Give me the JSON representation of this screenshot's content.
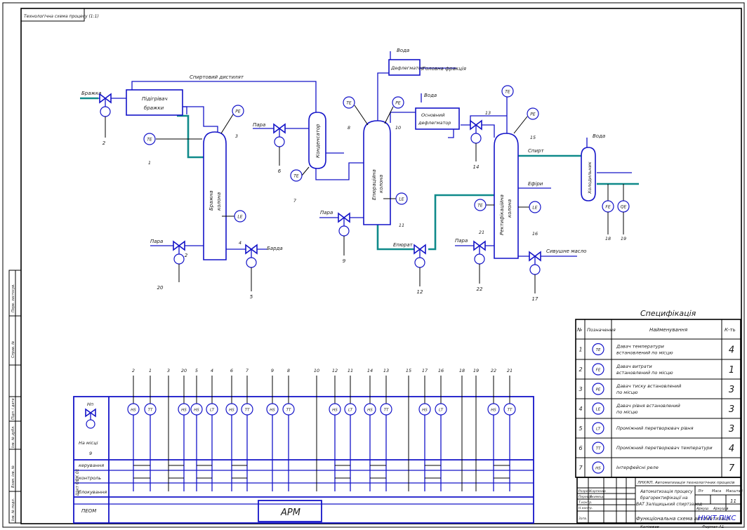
{
  "stamp_corner": "Технологічна схема процесу (1:1)",
  "diagram": {
    "streams": {
      "brazhka_in": "Бражка",
      "spirt_vidpr": "Спиртовий дистилят",
      "para_1": "Пара",
      "para_2": "Пара",
      "para_3": "Пара",
      "para_4": "Пара",
      "barda": "Барда",
      "voda_1": "Вода",
      "voda_2": "Вода",
      "voda_3": "Вода",
      "golovna_fr": "Головна фракція",
      "epyurat": "Епюрат",
      "spirt_out": "Спирт",
      "efiry": "Ефіри",
      "sivushni": "Сивушне масло"
    },
    "equipment": {
      "pidigrivach": [
        "Підігрівач",
        "бражки"
      ],
      "kolona_brazhna": [
        "Бражна",
        "колона"
      ],
      "kondensator": "Конденсатор",
      "kolona_epyur": [
        "Епюраційна",
        "колона"
      ],
      "defleg_1": "Дефлегматор",
      "defleg_2": [
        "Основний",
        "дефлегматор"
      ],
      "kolona_rekt": [
        "Ректифікаційна",
        "колона"
      ],
      "kholodylnyk": "Холодильник"
    },
    "instruments": {
      "i1": {
        "tag": "TE",
        "num": "1"
      },
      "i3": {
        "tag": "PE",
        "num": "3"
      },
      "i4": {
        "tag": "LE",
        "num": "4"
      },
      "i7": {
        "tag": "TE",
        "num": "7"
      },
      "i8": {
        "tag": "TE",
        "num": "8"
      },
      "i10": {
        "tag": "PE",
        "num": "10"
      },
      "i11": {
        "tag": "LE",
        "num": "11"
      },
      "i13": {
        "tag": "TE",
        "num": "13"
      },
      "i15": {
        "tag": "PE",
        "num": "15"
      },
      "i16": {
        "tag": "LE",
        "num": "16"
      },
      "i18": {
        "tag": "FE",
        "num": "18"
      },
      "i19": {
        "tag": "QE",
        "num": "19"
      },
      "i21": {
        "tag": "TE",
        "num": "21"
      }
    },
    "valves": {
      "v2": "2",
      "v5": "5",
      "v6": "6",
      "v9": "9",
      "v12": "12",
      "v14": "14",
      "v17": "17",
      "v20": "20",
      "v22": "22",
      "v2b": "2"
    }
  },
  "control_panel": {
    "top_numbers": [
      "2",
      "1",
      "3",
      "20",
      "5",
      "4",
      "6",
      "7",
      "9",
      "8",
      "10",
      "12",
      "11",
      "14",
      "13",
      "15",
      "17",
      "16",
      "18",
      "19",
      "22",
      "21"
    ],
    "field_devices": [
      "HS",
      "TT",
      "HS",
      "HS",
      "LT",
      "HS",
      "TT",
      "HS",
      "TT",
      "HS",
      "LT",
      "HS",
      "TT",
      "HS",
      "LT",
      "HS",
      "TT"
    ],
    "left_block": {
      "hn": "Нп",
      "label": "На місці",
      "num": "9"
    },
    "rows": [
      "керування",
      "контроль",
      "блокування"
    ],
    "cabinet_label": "Щит ОВК 01",
    "pc_label": "ПЕОМ",
    "arm_label": "АРМ"
  },
  "specification": {
    "title": "Специфікація",
    "headers": [
      "№",
      "Позначення",
      "Найменування",
      "К-ть"
    ],
    "rows": [
      {
        "n": "1",
        "sym": "TE",
        "name": [
          "Давач температури",
          "встановлений по місцю"
        ],
        "qty": "4"
      },
      {
        "n": "2",
        "sym": "FE",
        "name": [
          "Давач витрати",
          "встановлений по місцю"
        ],
        "qty": "1"
      },
      {
        "n": "3",
        "sym": "PE",
        "name": [
          "Давач тиску встановлений",
          "по місцю"
        ],
        "qty": "3"
      },
      {
        "n": "4",
        "sym": "LE",
        "name": [
          "Давач рівня встановлений",
          "по місцю"
        ],
        "qty": "3"
      },
      {
        "n": "5",
        "sym": "LT",
        "name": [
          "Проміжний перетворювач рівня"
        ],
        "qty": "3"
      },
      {
        "n": "6",
        "sym": "TT",
        "name": [
          "Проміжний перетворювач температури"
        ],
        "qty": "4"
      },
      {
        "n": "7",
        "sym": "HS",
        "name": [
          "Інтерфейсні реле"
        ],
        "qty": "7"
      }
    ]
  },
  "title_block": {
    "code": "ЛНУ/КП. Автоматизація технологічних процесів",
    "doc_title": [
      "Автоматизація процесу",
      "брагоректифікації на",
      "ВАТ Заліщицький спиртзавод"
    ],
    "sheet_title": "Функціональна схема автоматизації",
    "org": "НУХТ ПІКС",
    "lit": "Літ",
    "mass": "Маса",
    "scale": "Масштаб",
    "sheet": "Аркуш",
    "sheets": "Аркушів",
    "sheets_num": "11",
    "copied": "Копіював",
    "format": "Формат А1",
    "roles": [
      "Розроб.",
      "Перевір.",
      "Т.контр.",
      "Н.контр.",
      "Затв."
    ],
    "names": [
      "Карпенко",
      "Якимець"
    ]
  },
  "left_strip": [
    "Перв. застосув.",
    "Справ. №",
    "Підп. і дата",
    "Інв. № дубл.",
    "Взам. інв. №",
    "Підп. і дата",
    "Інв. № подл."
  ]
}
